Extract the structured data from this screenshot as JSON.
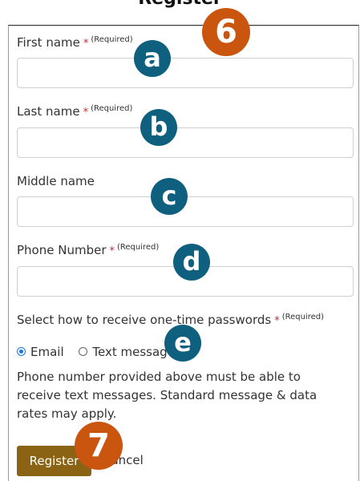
{
  "page": {
    "heading": "Register"
  },
  "form": {
    "first_name": {
      "label": "First name",
      "required_mark": "*",
      "required_text": "(Required)",
      "value": ""
    },
    "last_name": {
      "label": "Last name",
      "required_mark": "*",
      "required_text": "(Required)",
      "value": ""
    },
    "middle_name": {
      "label": "Middle name",
      "value": ""
    },
    "phone_number": {
      "label": "Phone Number",
      "required_mark": "*",
      "required_text": "(Required)",
      "value": ""
    },
    "otp": {
      "label": "Select how to receive one-time passwords",
      "required_mark": "*",
      "required_text": "(Required)",
      "options": [
        {
          "label": "Email",
          "selected": true
        },
        {
          "label": "Text message",
          "selected": false
        }
      ]
    },
    "note": "Phone number provided above must be able to receive text messages. Standard message & data rates may apply.",
    "register_label": "Register",
    "cancel_label": "Cancel"
  },
  "annotations": {
    "step_6": "6",
    "step_7": "7",
    "a": "a",
    "b": "b",
    "c": "c",
    "d": "d",
    "e": "e"
  },
  "colors": {
    "step_badge": "#c9550f",
    "letter_badge": "#0f5f7f",
    "register_button": "#8a6414",
    "required_star": "#c62828",
    "radio_selected": "#1a73e8"
  }
}
